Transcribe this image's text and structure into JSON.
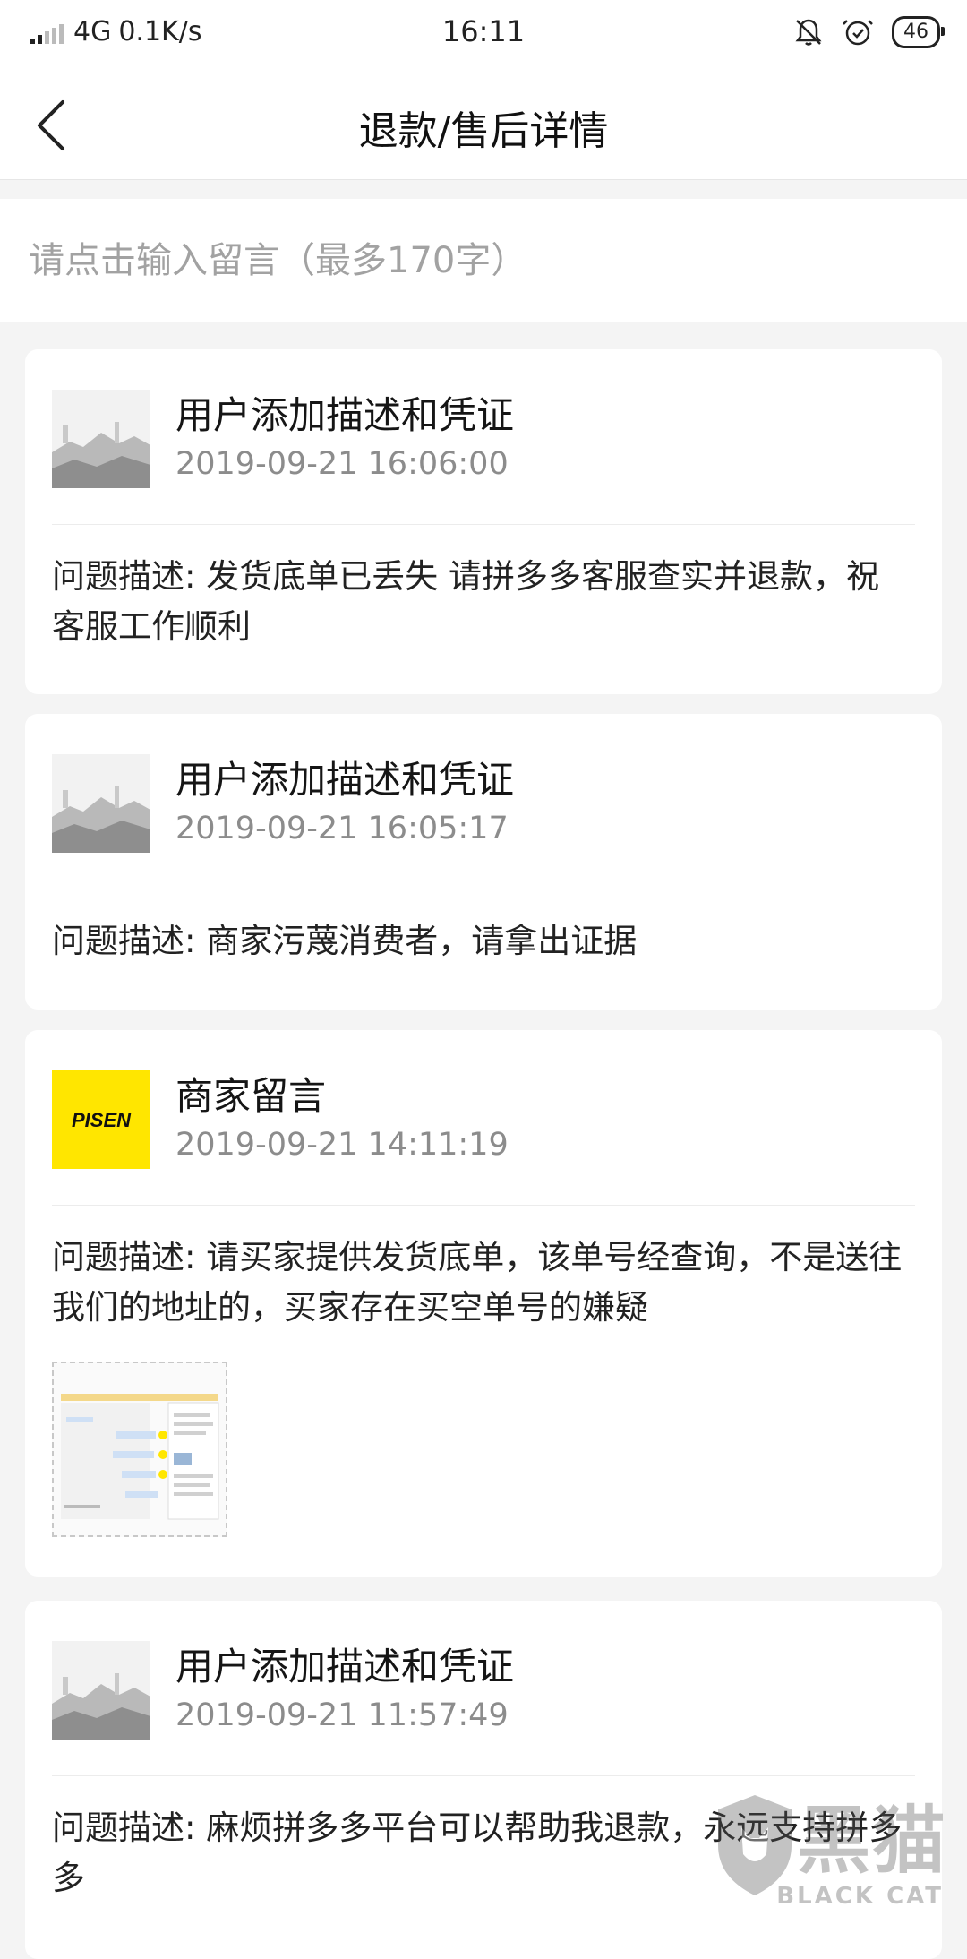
{
  "status_bar": {
    "network": "4G",
    "speed": "0.1K/s",
    "time": "16:11",
    "battery": "46"
  },
  "header": {
    "title": "退款/售后详情"
  },
  "message_input": {
    "placeholder": "请点击输入留言（最多170字）"
  },
  "entries": [
    {
      "title": "用户添加描述和凭证",
      "time": "2019-09-21 16:06:00",
      "description": "问题描述: 发货底单已丢失 请拼多多客服查实并退款，祝客服工作顺利",
      "avatar": "user-avatar"
    },
    {
      "title": "用户添加描述和凭证",
      "time": "2019-09-21 16:05:17",
      "description": "问题描述: 商家污蔑消费者，请拿出证据",
      "avatar": "user-avatar"
    },
    {
      "title": "商家留言",
      "time": "2019-09-21 14:11:19",
      "description": "问题描述: 请买家提供发货底单，该单号经查询，不是送往我们的地址的，买家存在买空单号的嫌疑",
      "avatar": "merchant-logo",
      "logo_text": "PISEN"
    },
    {
      "title": "用户添加描述和凭证",
      "time": "2019-09-21 11:57:49",
      "description": "问题描述: 麻烦拼多多平台可以帮助我退款，永远支持拼多多",
      "avatar": "user-avatar"
    }
  ],
  "watermark": {
    "title": "黑猫",
    "subtitle": "BLACK CAT"
  },
  "colors": {
    "logo_yellow": "#ffe600",
    "background": "#f4f4f4",
    "time_gray": "#8c8c8c"
  }
}
